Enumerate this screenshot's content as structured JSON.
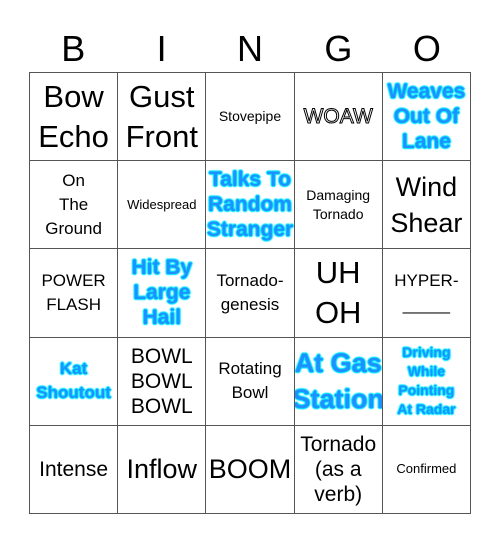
{
  "header": {
    "letters": [
      "B",
      "I",
      "N",
      "G",
      "O"
    ]
  },
  "colors": {
    "highlight_text": "#1e90ff",
    "highlight_glow": "#00e5ff",
    "grid_line": "#555555",
    "text": "#000000"
  },
  "cells": [
    {
      "text": "Bow\nEcho",
      "style": "s-xl"
    },
    {
      "text": "Gust\nFront",
      "style": "s-xl"
    },
    {
      "text": "Stovepipe",
      "style": "s-xs"
    },
    {
      "text": "WOAW",
      "style": "outline"
    },
    {
      "text": "Weaves\nOut Of\nLane",
      "style": "s-md blue"
    },
    {
      "text": "On\nThe\nGround",
      "style": "s-sm"
    },
    {
      "text": "Widespread",
      "style": "s-xxs"
    },
    {
      "text": "Talks To\nRandom\nStranger",
      "style": "s-md blue"
    },
    {
      "text": "Damaging\nTornado",
      "style": "s-xs"
    },
    {
      "text": "Wind\nShear",
      "style": "s-lg"
    },
    {
      "text": "POWER\nFLASH",
      "style": "s-sm"
    },
    {
      "text": "Hit By\nLarge\nHail",
      "style": "s-md blue"
    },
    {
      "text": "Tornado-\ngenesis",
      "style": "s-sm"
    },
    {
      "text": "UH\nOH",
      "style": "s-xl"
    },
    {
      "text": "HYPER-\n_____",
      "style": "s-sm"
    },
    {
      "text": "Kat\nShoutout",
      "style": "s-sm blue"
    },
    {
      "text": "BOWL\nBOWL\nBOWL",
      "style": "s-md"
    },
    {
      "text": "Rotating\nBowl",
      "style": "s-sm"
    },
    {
      "text": "At Gas\nStation",
      "style": "s-lg blue"
    },
    {
      "text": "Driving\nWhile\nPointing\nAt Radar",
      "style": "s-xs blue"
    },
    {
      "text": "Intense",
      "style": "s-md"
    },
    {
      "text": "Inflow",
      "style": "s-lg"
    },
    {
      "text": "BOOM",
      "style": "s-lg"
    },
    {
      "text": "Tornado\n(as a\nverb)",
      "style": "s-md"
    },
    {
      "text": "Confirmed",
      "style": "s-xxs"
    }
  ]
}
